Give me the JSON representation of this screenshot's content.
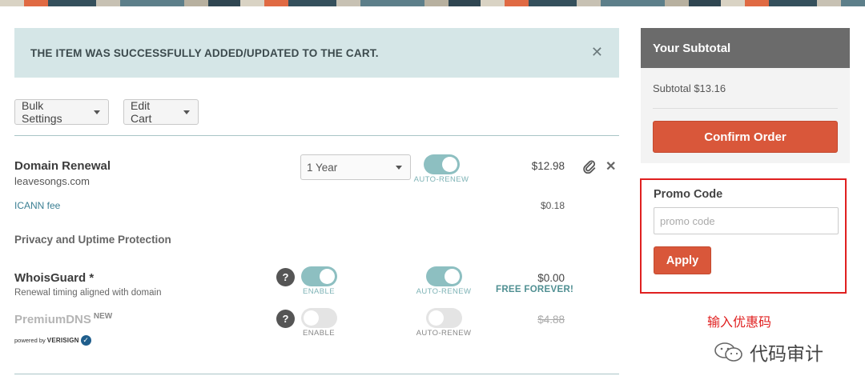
{
  "alert": {
    "message": "THE ITEM WAS SUCCESSFULLY ADDED/UPDATED TO THE CART.",
    "close": "✕"
  },
  "toolbar": {
    "bulk_settings": "Bulk Settings",
    "edit_cart": "Edit Cart"
  },
  "items": {
    "renewal": {
      "title": "Domain Renewal",
      "domain": "leavesongs.com",
      "term": "1 Year",
      "auto_renew_label": "AUTO-RENEW",
      "price": "$12.98",
      "icann_label": "ICANN fee",
      "icann_price": "$0.18"
    },
    "privacy_heading": "Privacy and Uptime Protection",
    "whoisguard": {
      "title": "WhoisGuard *",
      "desc": "Renewal timing aligned with domain",
      "enable_label": "ENABLE",
      "auto_renew_label": "AUTO-RENEW",
      "price": "$0.00",
      "free_label": "FREE FOREVER!"
    },
    "premiumdns": {
      "title": "PremiumDNS",
      "new_tag": "NEW",
      "powered_by": "powered by",
      "verisign": "VERISIGN",
      "enable_label": "ENABLE",
      "auto_renew_label": "AUTO-RENEW",
      "price": "$4.88"
    },
    "help_glyph": "?"
  },
  "summary": {
    "title": "Your Subtotal",
    "subtotal": "Subtotal $13.16",
    "confirm": "Confirm Order"
  },
  "promo": {
    "title": "Promo Code",
    "placeholder": "promo code",
    "apply": "Apply"
  },
  "annotation": "输入优惠码",
  "watermark": "代码审计",
  "colors": {
    "accent": "#d9573a",
    "toggle_on": "#8dbfc1",
    "alert_bg": "#d5e6e7",
    "highlight": "#e02020"
  }
}
